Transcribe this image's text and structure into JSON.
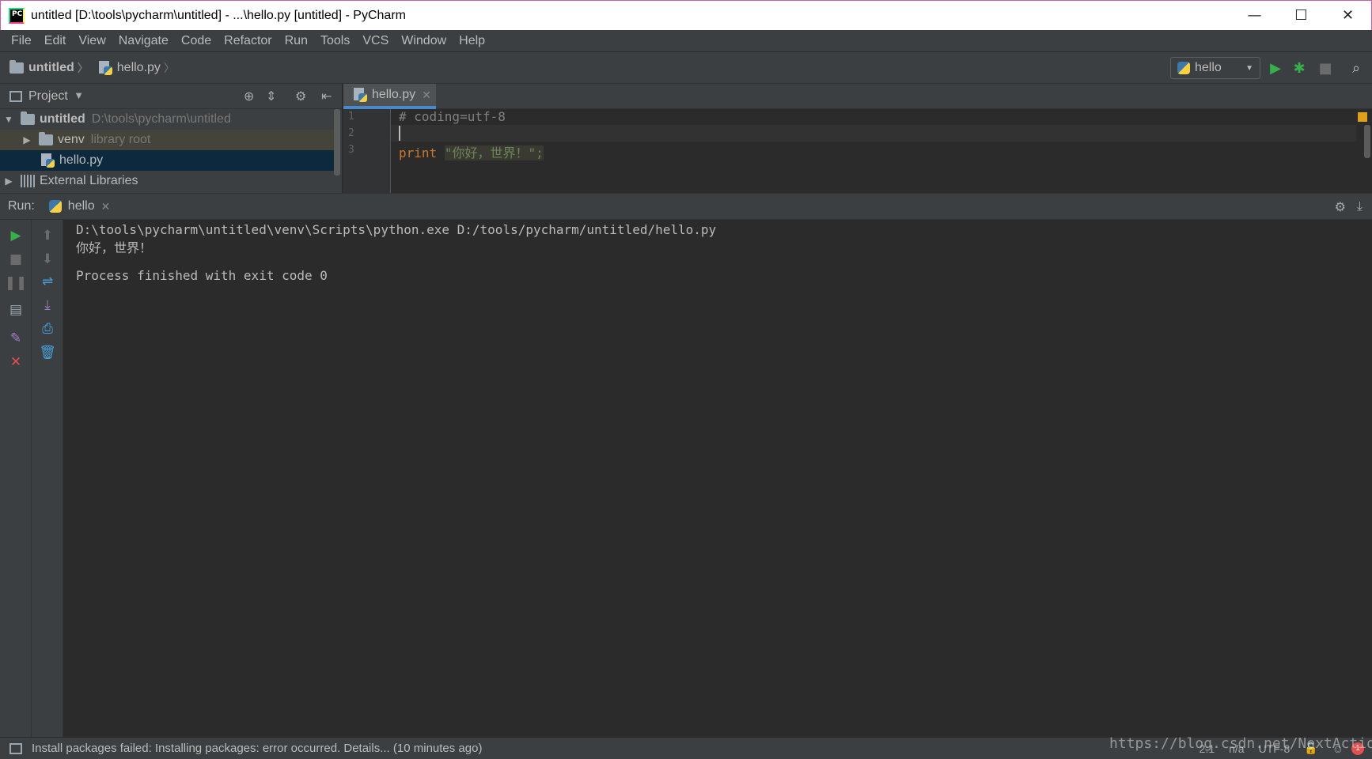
{
  "window": {
    "app_icon_text": "PC",
    "title": "untitled [D:\\tools\\pycharm\\untitled] - ...\\hello.py [untitled] - PyCharm",
    "minimize": "—",
    "maximize": "☐",
    "close": "✕"
  },
  "menu": [
    "File",
    "Edit",
    "View",
    "Navigate",
    "Code",
    "Refactor",
    "Run",
    "Tools",
    "VCS",
    "Window",
    "Help"
  ],
  "breadcrumb": {
    "project": "untitled",
    "file": "hello.py"
  },
  "run_config": {
    "name": "hello"
  },
  "project_panel": {
    "title": "Project",
    "tree": {
      "root_name": "untitled",
      "root_path": "D:\\tools\\pycharm\\untitled",
      "venv_name": "venv",
      "venv_note": "library root",
      "file": "hello.py",
      "external": "External Libraries"
    }
  },
  "editor": {
    "tab": "hello.py",
    "lines": [
      {
        "no": "1",
        "comment": "# coding=utf-8"
      },
      {
        "no": "2"
      },
      {
        "no": "3",
        "keyword": "print",
        "string": "\"你好，世界！\";"
      }
    ]
  },
  "run_panel": {
    "label": "Run:",
    "tab": "hello",
    "output": [
      "D:\\tools\\pycharm\\untitled\\venv\\Scripts\\python.exe D:/tools/pycharm/untitled/hello.py",
      "你好，世界！",
      "",
      "Process finished with exit code 0"
    ]
  },
  "status": {
    "message": "Install packages failed: Installing packages: error occurred. Details... (10 minutes ago)",
    "position": "2:1",
    "line_sep": "n/a",
    "encoding": "UTF-8",
    "errors": "1",
    "watermark": "https://blog.csdn.net/NextAction"
  },
  "colors": {
    "run_green": "#35b04a",
    "stop_red": "#e54f4f",
    "accent_blue": "#4a88c7",
    "warning_yellow": "#e0a11a"
  }
}
